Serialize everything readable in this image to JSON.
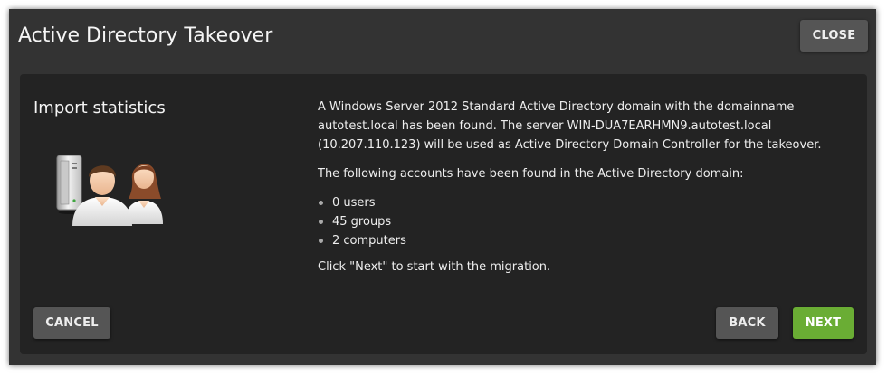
{
  "dialog": {
    "title": "Active Directory Takeover",
    "close_label": "CLOSE"
  },
  "panel": {
    "heading": "Import statistics",
    "illustration": "server-and-users-icon",
    "paragraph1": "A Windows Server 2012 Standard Active Directory domain with the domainname autotest.local has been found. The server WIN-DUA7EARHMN9.autotest.local (10.207.110.123) will be used as Active Directory Domain Controller for the takeover.",
    "paragraph2": "The following accounts have been found in the Active Directory domain:",
    "accounts": [
      "0 users",
      "45 groups",
      "2 computers"
    ],
    "paragraph3": "Click \"Next\" to start with the migration."
  },
  "footer": {
    "cancel_label": "CANCEL",
    "back_label": "BACK",
    "next_label": "NEXT"
  },
  "colors": {
    "dialog_bg": "#333333",
    "panel_bg": "#232323",
    "button_bg": "#555555",
    "primary_accent": "#6aad34"
  }
}
